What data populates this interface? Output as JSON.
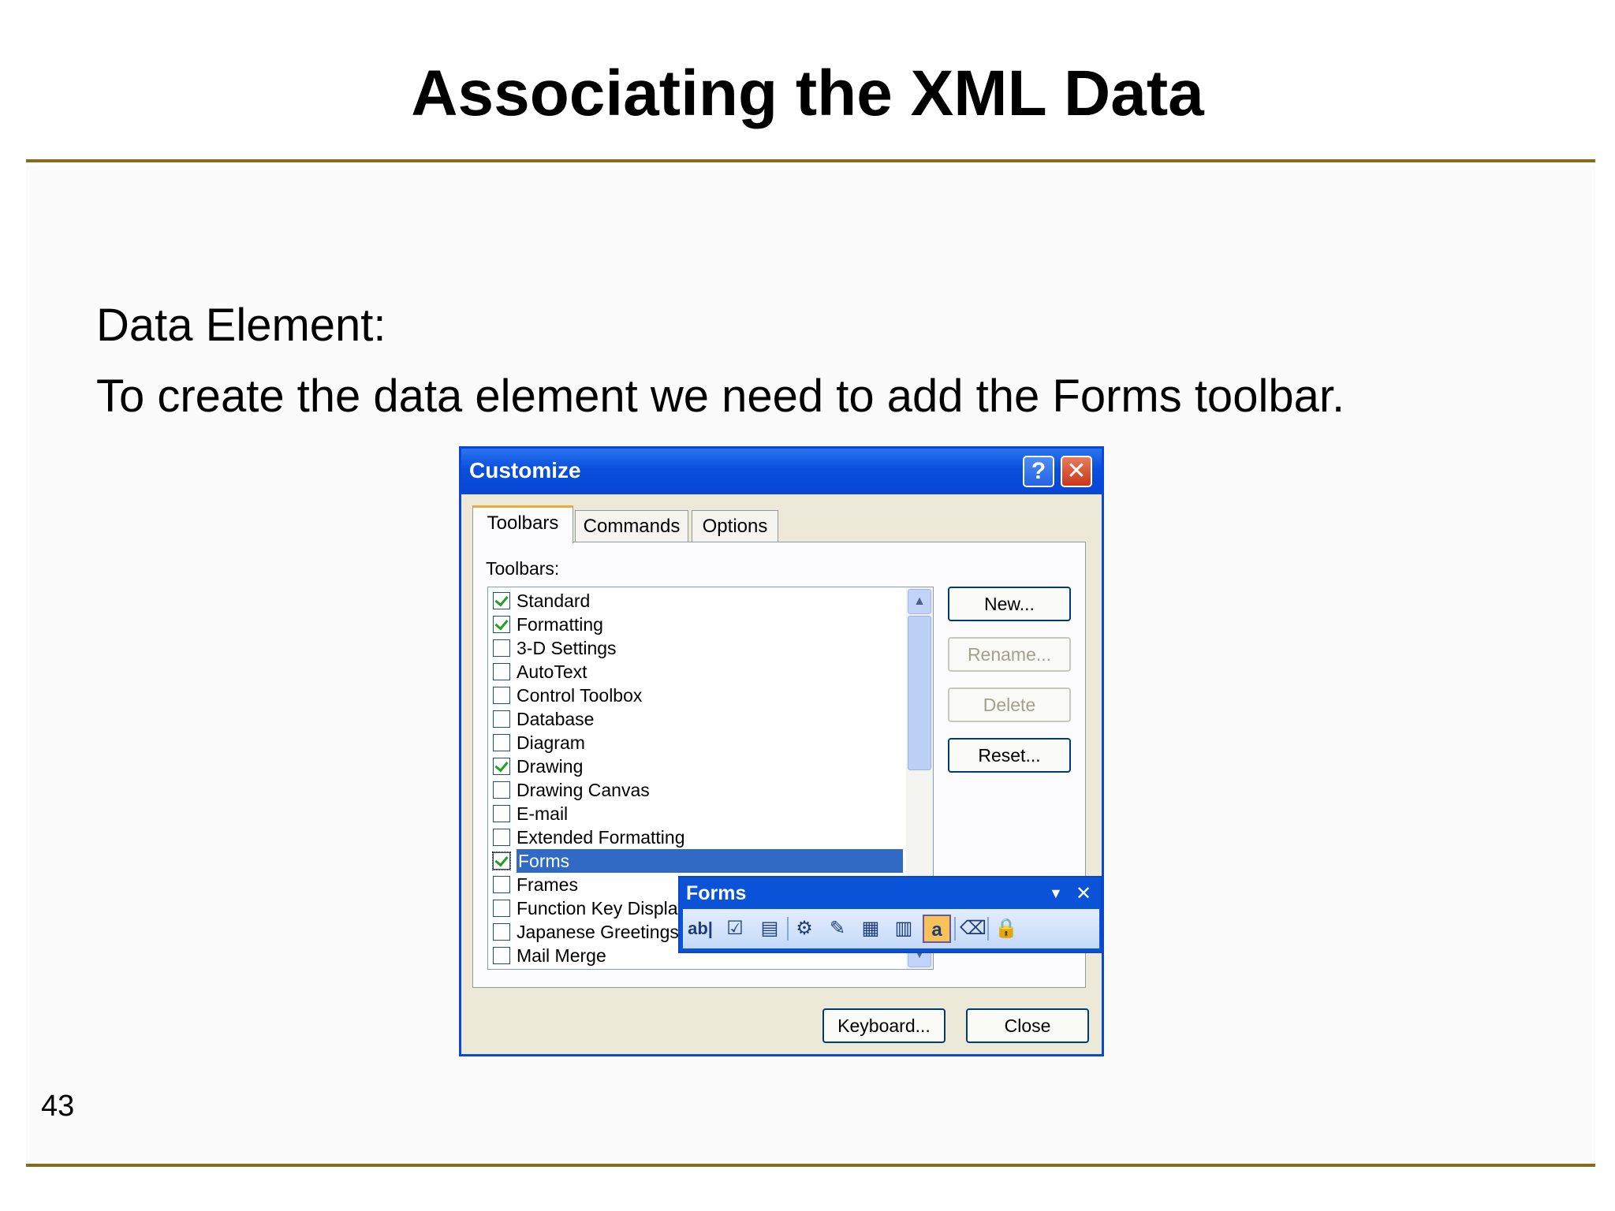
{
  "slide": {
    "title": "Associating the XML Data",
    "line1": "Data Element:",
    "line2": "To create the data element we need to add the Forms toolbar.",
    "page_number": "43"
  },
  "dialog": {
    "title": "Customize",
    "tabs": [
      {
        "label": "Toolbars",
        "active": true
      },
      {
        "label": "Commands",
        "active": false
      },
      {
        "label": "Options",
        "active": false
      }
    ],
    "list_label": "Toolbars:",
    "toolbars": [
      {
        "label": "Standard",
        "checked": true
      },
      {
        "label": "Formatting",
        "checked": true
      },
      {
        "label": "3-D Settings",
        "checked": false
      },
      {
        "label": "AutoText",
        "checked": false
      },
      {
        "label": "Control Toolbox",
        "checked": false
      },
      {
        "label": "Database",
        "checked": false
      },
      {
        "label": "Diagram",
        "checked": false
      },
      {
        "label": "Drawing",
        "checked": true
      },
      {
        "label": "Drawing Canvas",
        "checked": false
      },
      {
        "label": "E-mail",
        "checked": false
      },
      {
        "label": "Extended Formatting",
        "checked": false
      },
      {
        "label": "Forms",
        "checked": true,
        "selected": true
      },
      {
        "label": "Frames",
        "checked": false
      },
      {
        "label": "Function Key Display",
        "checked": false
      },
      {
        "label": "Japanese Greetings",
        "checked": false
      },
      {
        "label": "Mail Merge",
        "checked": false
      }
    ],
    "buttons": {
      "new": "New...",
      "rename": "Rename...",
      "delete": "Delete",
      "reset": "Reset...",
      "keyboard": "Keyboard...",
      "close": "Close"
    },
    "help_glyph": "?",
    "close_glyph": "✕"
  },
  "forms_toolbar": {
    "title": "Forms",
    "dropdown_glyph": "▼",
    "close_glyph": "✕",
    "icons": [
      {
        "name": "text-form-field-icon",
        "glyph": "ab|"
      },
      {
        "name": "check-box-form-field-icon",
        "glyph": "☑"
      },
      {
        "name": "drop-down-form-field-icon",
        "glyph": "▤"
      },
      {
        "name": "form-field-options-icon",
        "glyph": "⚙"
      },
      {
        "name": "draw-table-icon",
        "glyph": "✎"
      },
      {
        "name": "insert-table-icon",
        "glyph": "▦"
      },
      {
        "name": "insert-frame-icon",
        "glyph": "▥"
      },
      {
        "name": "form-field-shading-icon",
        "glyph": "a"
      },
      {
        "name": "reset-form-fields-icon",
        "glyph": "⌫"
      },
      {
        "name": "protect-form-icon",
        "glyph": "🔒"
      }
    ],
    "colors": {
      "titlebar": "#0a52d8",
      "active_icon": "#f8c25a"
    }
  },
  "colors": {
    "rule": "#8a6a1e",
    "dialog_titlebar": "#0a4edc",
    "dialog_face": "#ece9d8",
    "selection": "#316ac5"
  }
}
